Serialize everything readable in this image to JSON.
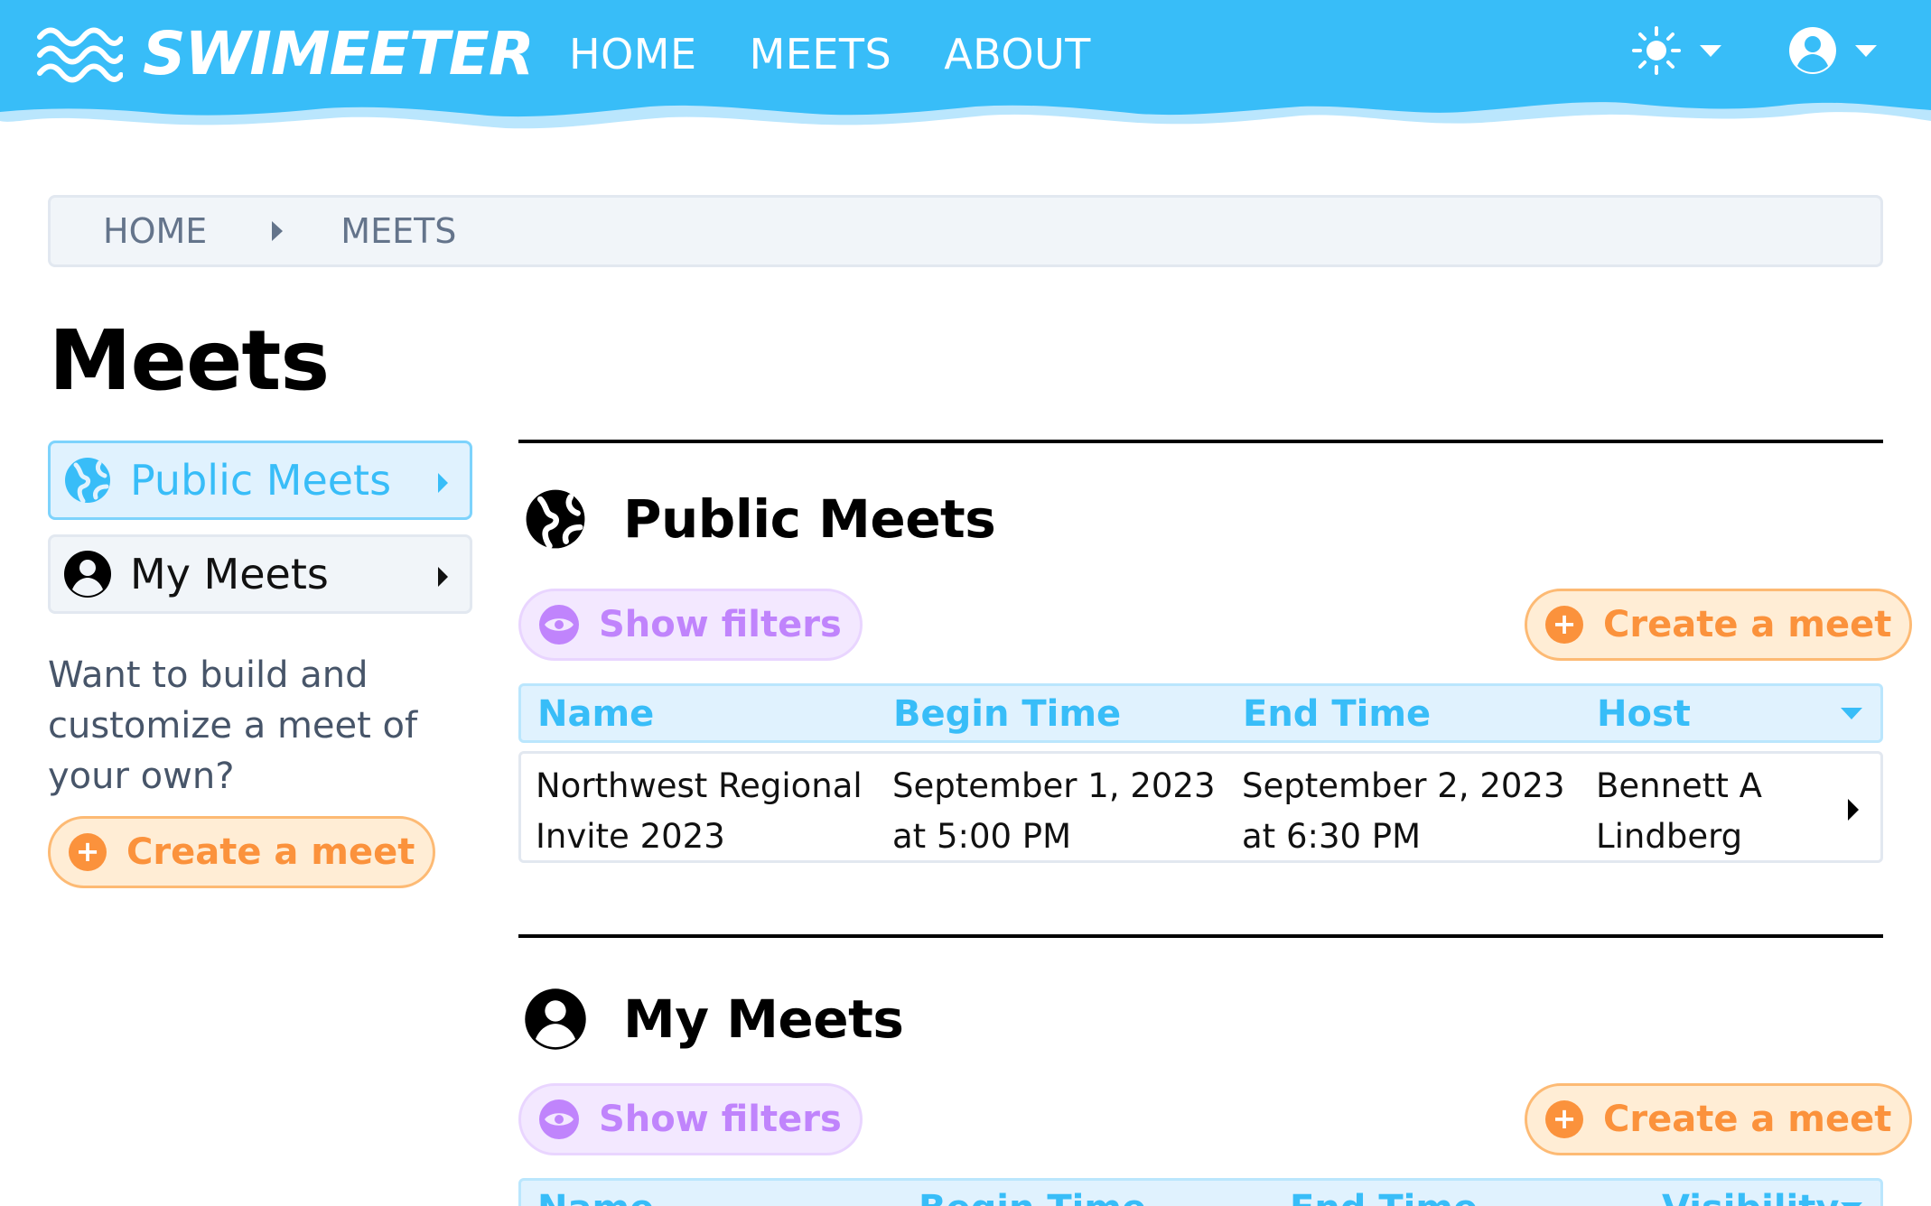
{
  "app": {
    "brand": "SWIMEETER",
    "nav": [
      "HOME",
      "MEETS",
      "ABOUT"
    ]
  },
  "colors": {
    "brand_blue": "#38bdf8",
    "accent_orange": "#fb923c",
    "accent_purple": "#c084fc"
  },
  "icons": {
    "logo": "waves-icon",
    "theme": "sun-icon",
    "user": "user-circle-icon",
    "public": "globe-icon",
    "filters": "eye-icon",
    "add": "plus-circle-icon"
  },
  "breadcrumb": [
    "HOME",
    "MEETS"
  ],
  "page": {
    "title": "Meets"
  },
  "sidebar": {
    "items": [
      {
        "label": "Public Meets"
      },
      {
        "label": "My Meets"
      }
    ],
    "prompt": "Want to build and customize a meet of your own?",
    "create_label": "Create a meet"
  },
  "public_meets": {
    "title": "Public Meets",
    "show_filters": "Show filters",
    "create_label": "Create a meet",
    "columns": [
      "Name",
      "Begin Time",
      "End Time",
      "Host"
    ],
    "rows": [
      {
        "name_line1": "Northwest Regional",
        "name_line2": "Invite 2023",
        "begin_line1": "September 1, 2023",
        "begin_line2": "at 5:00 PM",
        "end_line1": "September 2, 2023",
        "end_line2": "at 6:30 PM",
        "host_line1": "Bennett A",
        "host_line2": "Lindberg"
      }
    ]
  },
  "my_meets": {
    "title": "My Meets",
    "show_filters": "Show filters",
    "create_label": "Create a meet",
    "columns": [
      "Name",
      "Begin Time",
      "End Time",
      "Visibility"
    ]
  }
}
